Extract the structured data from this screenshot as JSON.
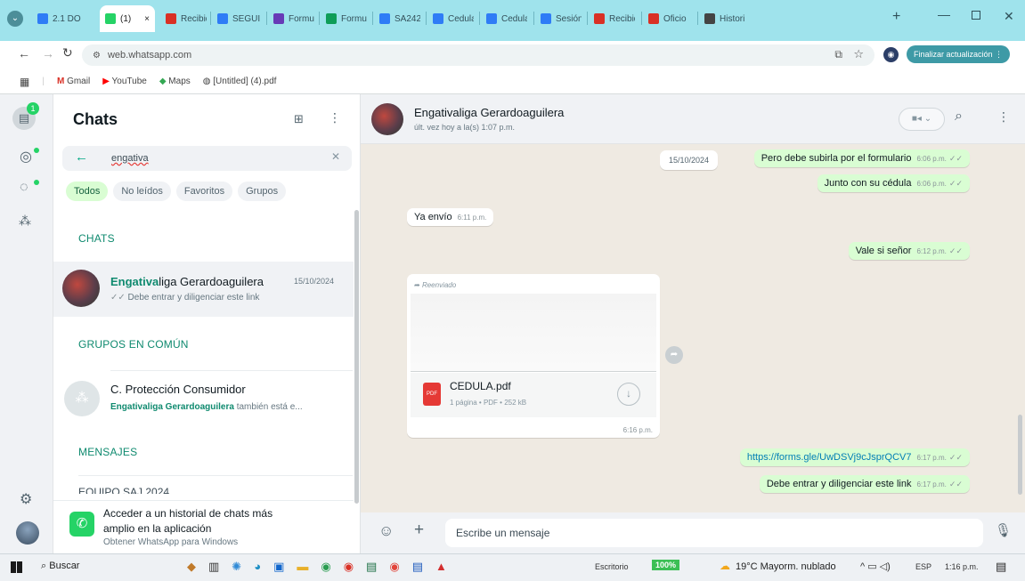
{
  "browser": {
    "tabs": [
      {
        "label": "2.1 DO",
        "icon_color": "#2f7cf6",
        "active": false
      },
      {
        "label": "(1)",
        "icon_color": "#25d366",
        "active": true,
        "close": "×"
      },
      {
        "label": "Recibid",
        "icon_color": "#d93025",
        "active": false
      },
      {
        "label": "SEGUI",
        "icon_color": "#2f7cf6",
        "active": false
      },
      {
        "label": "Formu",
        "icon_color": "#673ab7",
        "active": false
      },
      {
        "label": "Formu",
        "icon_color": "#0f9d58",
        "active": false
      },
      {
        "label": "SA242",
        "icon_color": "#2f7cf6",
        "active": false
      },
      {
        "label": "Cedula",
        "icon_color": "#2f7cf6",
        "active": false
      },
      {
        "label": "Cedula",
        "icon_color": "#2f7cf6",
        "active": false
      },
      {
        "label": "Sesión",
        "icon_color": "#2f7cf6",
        "active": false
      },
      {
        "label": "Recibid",
        "icon_color": "#d93025",
        "active": false
      },
      {
        "label": "Oficio",
        "icon_color": "#d93025",
        "active": false
      },
      {
        "label": "Histori",
        "icon_color": "#444444",
        "active": false
      }
    ],
    "new_tab": "+",
    "url": "web.whatsapp.com",
    "update_button": "Finalizar actualización",
    "bookmarks": [
      "Gmail",
      "YouTube",
      "Maps",
      "[Untitled] (4).pdf"
    ]
  },
  "rail": {
    "badge": "1"
  },
  "sidebar": {
    "title": "Chats",
    "search_value": "engativa",
    "filters": [
      "Todos",
      "No leídos",
      "Favoritos",
      "Grupos"
    ],
    "section_chats": "CHATS",
    "chat": {
      "name_highlight": "Engativa",
      "name_rest": "liga Gerardoaguilera",
      "date": "15/10/2024",
      "preview": "Debe entrar y diligenciar este link"
    },
    "section_groups": "GRUPOS EN COMÚN",
    "group": {
      "name": "C. Protección Consumidor",
      "preview_bold": "Engativaliga Gerardoaguilera",
      "preview_rest": " también está e..."
    },
    "section_messages": "MENSAJES",
    "message_preview": "EQUIPO SAJ 2024",
    "promo": {
      "line1": "Acceder a un historial de chats más",
      "line2": "amplio en la aplicación",
      "line3": "Obtener WhatsApp para Windows"
    }
  },
  "chat": {
    "name": "Engativaliga Gerardoaguilera",
    "status": "últ. vez hoy a la(s) 1:07 p.m.",
    "date_chip": "15/10/2024",
    "messages": [
      {
        "text": "Pero debe subirla por el formulario",
        "time": "6:06 p.m."
      },
      {
        "text": "Junto con su cédula",
        "time": "6:06 p.m."
      },
      {
        "text": "Ya envío",
        "time": "6:11 p.m."
      },
      {
        "text": "Vale si señor",
        "time": "6:12 p.m."
      },
      {
        "text": "https://forms.gle/UwDSVj9cJsprQCV7",
        "time": "6:17 p.m."
      },
      {
        "text": "Debe entrar y diligenciar este link",
        "time": "6:17 p.m."
      }
    ],
    "forward": {
      "label": "Reenviado",
      "file_name": "CEDULA.pdf",
      "file_meta": "1 página • PDF • 252 kB",
      "file_badge": "PDF",
      "time": "6:16 p.m."
    },
    "input_placeholder": "Escribe un mensaje"
  },
  "taskbar": {
    "search": "Buscar",
    "desktop": "Escritorio",
    "battery": "100%",
    "weather": "19°C  Mayorm. nublado",
    "lang": "ESP",
    "clock": "1:16 p.m."
  },
  "colors": {
    "tab_strip": "#9fe3ec",
    "accent": "#25d366",
    "chat_bg": "#efeae2",
    "outgoing": "#d9fdd3",
    "highlight": "#0f8a6f"
  }
}
